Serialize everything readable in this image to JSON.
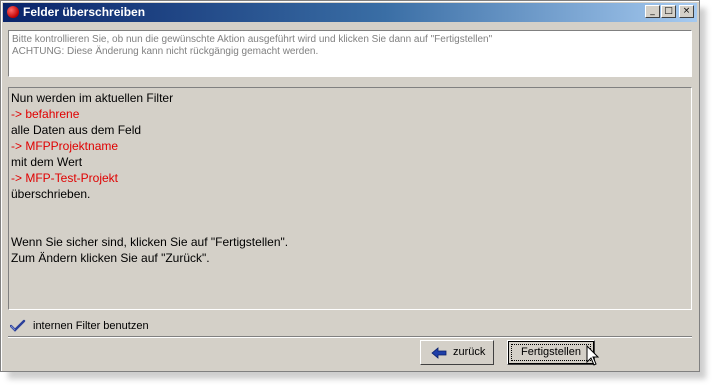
{
  "window": {
    "title": "Felder überschreiben",
    "controls": {
      "minimize": "_",
      "maximize": "□",
      "close": "×"
    }
  },
  "header": {
    "line1": "Bitte kontrollieren Sie, ob nun die gewünschte Aktion ausgeführt wird und klicken Sie dann auf \"Fertigstellen\"",
    "line2": "ACHTUNG: Diese Änderung kann nicht rückgängig gemacht werden."
  },
  "summary": {
    "line1": "Nun werden im aktuellen Filter",
    "line2": " -> befahrene",
    "line3": "alle Daten aus dem Feld",
    "line4": " -> MFPProjektname",
    "line5": " mit dem Wert",
    "line6": " -> MFP-Test-Projekt",
    "line7": "überschrieben.",
    "line8": "Wenn Sie sicher sind, klicken Sie auf \"Fertigstellen\".",
    "line9": "Zum Ändern klicken Sie auf \"Zurück\"."
  },
  "options": {
    "internal_filter_label": "internen Filter benutzen",
    "internal_filter_checked": true
  },
  "buttons": {
    "back_label": "zurück",
    "finish_label": "Fertigstellen"
  },
  "colors": {
    "title_start": "#0a246a",
    "title_end": "#a6caf0",
    "highlight_red": "#e00000",
    "face": "#d4d0c8"
  }
}
